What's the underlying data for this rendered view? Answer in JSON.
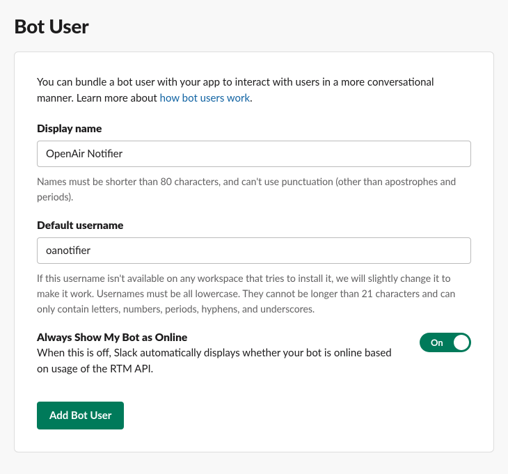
{
  "page": {
    "title": "Bot User"
  },
  "intro": {
    "text_before": "You can bundle a bot user with your app to interact with users in a more conversational manner. Learn more about ",
    "link_text": "how bot users work",
    "text_after": "."
  },
  "display_name": {
    "label": "Display name",
    "value": "OpenAir Notifier",
    "help": "Names must be shorter than 80 characters, and can't use punctuation (other than apostrophes and periods)."
  },
  "default_username": {
    "label": "Default username",
    "value": "oanotifier",
    "help": "If this username isn't available on any workspace that tries to install it, we will slightly change it to make it work. Usernames must be all lowercase. They cannot be longer than 21 characters and can only contain letters, numbers, periods, hyphens, and underscores."
  },
  "online_toggle": {
    "label": "Always Show My Bot as Online",
    "description": "When this is off, Slack automatically displays whether your bot is online based on usage of the RTM API.",
    "state_text": "On",
    "state": true
  },
  "submit": {
    "label": "Add Bot User"
  }
}
